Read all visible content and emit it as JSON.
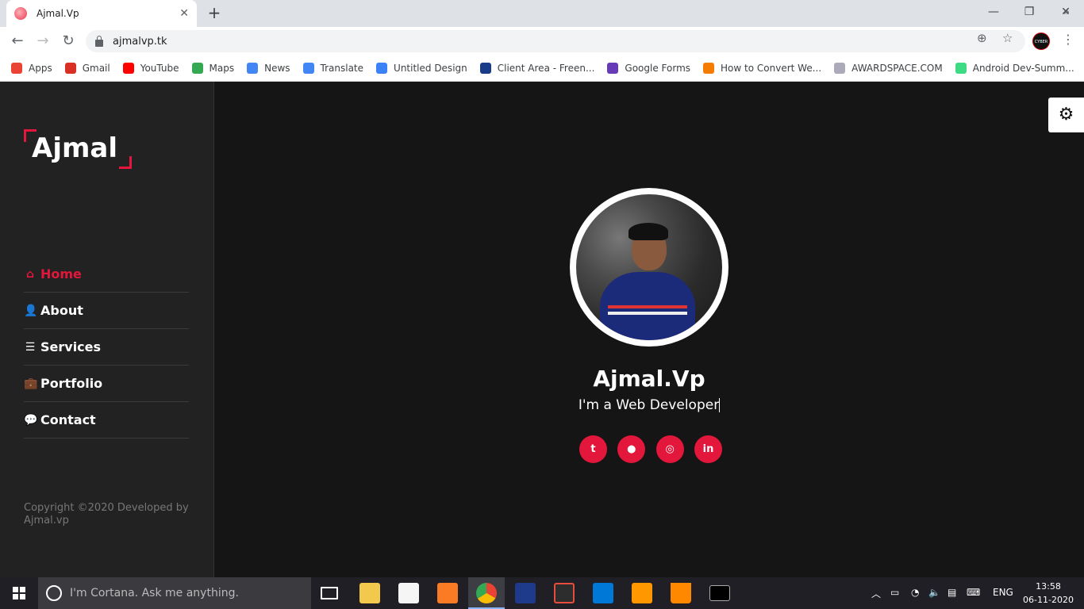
{
  "browser": {
    "tab_title": "Ajmal.Vp",
    "tab_close": "✕",
    "new_tab": "+",
    "url": "ajmalvp.tk",
    "window_controls": [
      "—",
      "❐",
      "✕"
    ]
  },
  "bookmarks": [
    {
      "label": "Apps",
      "icon": "apps-grid-icon",
      "color": "#ea4335"
    },
    {
      "label": "Gmail",
      "icon": "gmail-icon",
      "color": "#d93025"
    },
    {
      "label": "YouTube",
      "icon": "youtube-icon",
      "color": "#ff0000"
    },
    {
      "label": "Maps",
      "icon": "maps-icon",
      "color": "#34a853"
    },
    {
      "label": "News",
      "icon": "news-icon",
      "color": "#4285f4"
    },
    {
      "label": "Translate",
      "icon": "translate-icon",
      "color": "#4285f4"
    },
    {
      "label": "Untitled Design",
      "icon": "canva-icon",
      "color": "#3b82f6"
    },
    {
      "label": "Client Area - Freen...",
      "icon": "freenom-icon",
      "color": "#1a3a8a"
    },
    {
      "label": "Google Forms",
      "icon": "forms-icon",
      "color": "#673ab7"
    },
    {
      "label": "How to Convert We...",
      "icon": "blogger-icon",
      "color": "#f57c00"
    },
    {
      "label": "AWARDSPACE.COM",
      "icon": "awardspace-icon",
      "color": "#aab"
    },
    {
      "label": "Android Dev-Summ...",
      "icon": "android-icon",
      "color": "#3ddc84"
    }
  ],
  "bookmarks_more": "»",
  "site": {
    "logo": "Ajmal",
    "nav": [
      {
        "label": "Home",
        "icon": "⌂",
        "active": true
      },
      {
        "label": "About",
        "icon": "👤",
        "active": false
      },
      {
        "label": "Services",
        "icon": "☰",
        "active": false
      },
      {
        "label": "Portfolio",
        "icon": "💼",
        "active": false
      },
      {
        "label": "Contact",
        "icon": "💬",
        "active": false
      }
    ],
    "copyright": "Copyright ©2020 Developed by Ajmal.vp",
    "hero": {
      "name": "Ajmal.Vp",
      "role": "I'm a Web Developer"
    },
    "socials": [
      {
        "name": "twitter",
        "glyph": "t"
      },
      {
        "name": "github",
        "glyph": "●"
      },
      {
        "name": "instagram",
        "glyph": "◎"
      },
      {
        "name": "linkedin",
        "glyph": "in"
      }
    ],
    "settings_icon": "⚙",
    "accent_color": "#e3163b"
  },
  "taskbar": {
    "cortana_placeholder": "I'm Cortana. Ask me anything.",
    "language": "ENG",
    "time": "13:58",
    "date": "06-11-2020"
  }
}
